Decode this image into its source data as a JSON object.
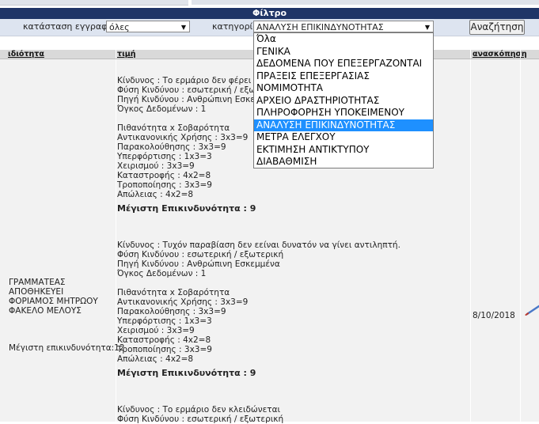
{
  "filter": {
    "title": "Φίλτρο",
    "status_label": "κατάσταση εγγραφών",
    "status_value": "όλες",
    "category_label": "κατηγορία",
    "category_value": "ΑΝΑΛΥΣΗ ΕΠΙΚΙΝΔΥΝΟΤΗΤΑΣ",
    "search_button": "Αναζήτηση",
    "options": [
      "Όλα",
      "ΓΕΝΙΚΑ",
      "ΔΕΔΟΜΕΝΑ ΠΟΥ ΕΠΕΞΕΡΓΑΖΟΝΤΑΙ",
      "ΠΡΑΞΕΙΣ ΕΠΕΞΕΡΓΑΣΙΑΣ",
      "ΝΟΜΙΜΟΤΗΤΑ",
      "ΑΡΧΕΙΟ ΔΡΑΣΤΗΡΙΟΤΗΤΑΣ",
      "ΠΛΗΡΟΦΟΡΗΣΗ ΥΠΟΚΕΙΜΕΝΟΥ",
      "ΑΝΑΛΥΣΗ ΕΠΙΚΙΝΔΥΝΟΤΗΤΑΣ",
      "ΜΕΤΡΑ ΕΛΕΓΧΟΥ",
      "ΕΚΤΙΜΗΣΗ ΑΝΤΙΚΤΥΠΟΥ",
      "ΔΙΑΒΑΘΜΙΣΗ"
    ],
    "selected_index": 7
  },
  "table": {
    "headers": {
      "property": "ιδιότητα",
      "value": "τιμή",
      "review": "ανασκόπηση"
    },
    "row": {
      "property_lines": [
        "ΓΡΑΜΜΑΤΕΑΣ",
        "ΑΠΟΘΗΚΕΥΕΙ",
        "ΦΟΡΙΑΜΟΣ ΜΗΤΡΩΟΥ",
        "ΦΑΚΕΛΟ ΜΕΛΟΥΣ"
      ],
      "property_max": "Μέγιστη επικινδυνότητα:12",
      "date": "8/10/2018",
      "blocks": [
        {
          "lines": [
            "Κίνδυνος : Το ερμάριο δεν φέρει μηχ",
            "Φύση Κινδύνου : εσωτερική / εξωτερ",
            "Πηγή Κινδύνου : Ανθρώπινη Εσκεμμ",
            "Όγκος Δεδομένων : 1"
          ],
          "factors": [
            "Πιθανότητα x Σοβαρότητα",
            "Αντικανονικής Χρήσης : 3x3=9",
            "Παρακολούθησης : 3x3=9",
            "Υπερφόρτισης : 1x3=3",
            "Χειρισμού : 3x3=9",
            "Καταστροφής : 4x2=8",
            "Τροποποίησης : 3x3=9",
            "Απώλειας : 4x2=8"
          ],
          "max": "Μέγιστη Επικινδυνότητα : 9"
        },
        {
          "lines": [
            "Κίνδυνος : Τυχόν παραβίαση δεν εείναι δυνατόν να γίνει αντιληπτή.",
            "Φύση Κινδύνου : εσωτερική / εξωτερική",
            "Πηγή Κινδύνου : Ανθρώπινη Εσκεμμένα",
            "Όγκος Δεδομένων : 1"
          ],
          "factors": [
            "Πιθανότητα x Σοβαρότητα",
            "Αντικανονικής Χρήσης : 3x3=9",
            "Παρακολούθησης : 3x3=9",
            "Υπερφόρτισης : 1x3=3",
            "Χειρισμού : 3x3=9",
            "Καταστροφής : 4x2=8",
            "Τροποποίησης : 3x3=9",
            "Απώλειας : 4x2=8"
          ],
          "max": "Μέγιστη Επικινδυνότητα : 9"
        },
        {
          "lines": [
            "Κίνδυνος : Το ερμάριο δεν κλειδώνεται",
            "Φύση Κινδύνου : εσωτερική / εξωτερική"
          ],
          "factors": [],
          "max": ""
        }
      ]
    }
  },
  "icons": {
    "edit": "pencil-icon",
    "dropdown_arrow": "triangle-down-icon"
  },
  "colors": {
    "header_bar": "#1f3567",
    "selected_option": "#1e90ff"
  }
}
